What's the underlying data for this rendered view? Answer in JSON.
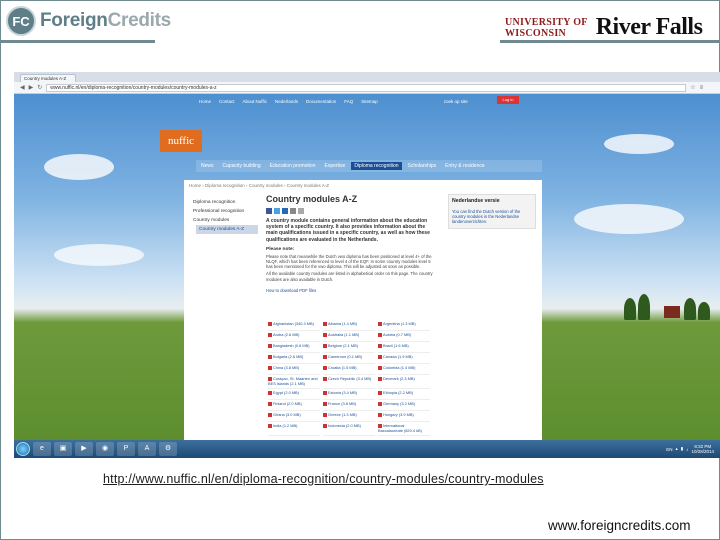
{
  "header": {
    "fc_badge": "FC",
    "fc_word_main": "Foreign",
    "fc_word_accent": "Credits",
    "uw_line1": "UNIVERSITY OF",
    "uw_line2": "WISCONSIN",
    "uw_name": "River Falls"
  },
  "browser": {
    "tab_title": "Country modules A-Z",
    "url": "www.nuffic.nl/en/diploma-recognition/country-modules/country-modules-a-z"
  },
  "site": {
    "logo": "nuffic",
    "topnav": [
      "Home",
      "Contact",
      "About Nuffic",
      "Nederlands",
      "Documentation",
      "FAQ",
      "Sitemap"
    ],
    "search_text": "zoek op site",
    "login_label": "Log in",
    "mainnav": [
      "News",
      "Capacity building",
      "Education promotion",
      "Expertise",
      "Diploma recognition",
      "Scholarships",
      "Entry & residence"
    ],
    "breadcrumb": "Home › Diploma recognition › Country modules › Country modules A-Z",
    "sidebar": [
      "Diploma recognition",
      "Professional recognition",
      "Country modules",
      "Country modules A-Z"
    ],
    "title": "Country modules A-Z",
    "intro": "A country module contains general information about the education system of a specific country. It also provides information about the main qualifications issued in a specific country, as well as how these qualifications are evaluated in the Netherlands.",
    "note_heading": "Please note:",
    "note_body": "Please note that meanwhile the Dutch vwo diploma has been positioned at level 4+ of the NLQF, which has been referenced to level 4 of the EQF. In some country modules level 5 has been mentioned for the vwo diploma. This will be adjusted as soon as possible.",
    "note_body2": "All the available country modules are listed in alphabetical order on this page. The country modules are also available in Dutch.",
    "howto": "How to download PDF files",
    "aside_heading": "Nederlandse versie",
    "aside_body": "You can find the Dutch version of the country modules in the Nederlandse landenoverzichten.",
    "modules": [
      "Afghanistan (340.3 MB)",
      "Albania (1.4 MB)",
      "Argentina (1.3 MB)",
      "Aruba (2.6 MB)",
      "Australia (1.1 MB)",
      "Austria (0.7 MB)",
      "Bangladesh (0.8 MB)",
      "Belgium (2.1 MB)",
      "Brazil (1.6 MB)",
      "Bulgaria (2.6 MB)",
      "Cameroon (0.1 MB)",
      "Canada (1.9 MB)",
      "China (3.8 MB)",
      "Croatia (1.5 MB)",
      "Colombia (1.4 MB)",
      "Curaçao, St. Maarten and BES islands (2.1 MB)",
      "Czech Republic (3.4 MB)",
      "Denmark (2.3 MB)",
      "Egypt (2.0 MB)",
      "Estonia (3.4 MB)",
      "Ethiopia (2.2 MB)",
      "Finland (2.0 MB)",
      "France (3.8 MB)",
      "Germany (3.2 MB)",
      "Ghana (3.0 MB)",
      "Greece (1.3 MB)",
      "Hungary (3.9 MB)",
      "India (1.2 MB)",
      "Indonesia (2.0 MB)",
      "International Baccalaureate (820.4 kB)"
    ]
  },
  "taskbar": {
    "lang": "EN",
    "time": "8:32 PM",
    "date": "10/28/2014"
  },
  "caption": {
    "url": "http://www.nuffic.nl/en/diploma-recognition/country-modules/country-modules",
    "website": "www.foreigncredits.com"
  }
}
